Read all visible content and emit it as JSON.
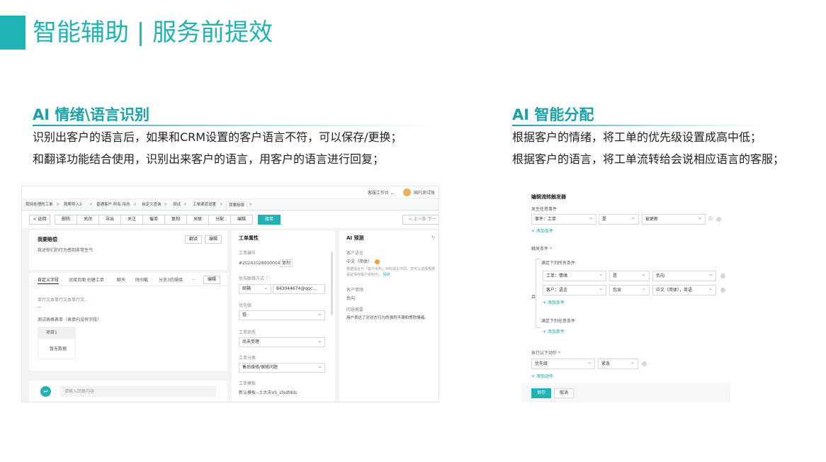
{
  "slide": {
    "title": "智能辅助 | 服务前提效"
  },
  "left_section": {
    "title": "AI 情绪\\语言识别",
    "lines": [
      "识别出客户的语言后，如果和CRM设置的客户语言不符，可以保存/更换；",
      "和翻译功能结合使用，识别出来客户的语言，用客户的语言进行回复；"
    ]
  },
  "right_section": {
    "title": "AI 智能分配",
    "lines": [
      "根据客户的情绪，将工单的优先级设置成高中低；",
      "根据客户的语言，将工单流转给会说相应语言的客服；"
    ]
  },
  "ticket_ui": {
    "topbar": {
      "workspace": "客服工作台 ⌄",
      "user": "国内测试账"
    },
    "tabs": [
      "我待处理的工单",
      "我帮导入2",
      "普通客户·所有·待办",
      "自定义查询",
      "测试",
      "工单渠道设置",
      "我要赔偿"
    ],
    "toolbar": {
      "back": "< 返回",
      "buttons": [
        "删除",
        "关闭",
        "导出",
        "关注",
        "催单",
        "复制",
        "关联",
        "分配",
        "编辑",
        "接单"
      ],
      "pager": "< 上一条 下一"
    },
    "subject": {
      "title": "我要赔偿",
      "body": "我对你们的行为感到非常生气",
      "translate": "翻译",
      "edit": "编辑"
    },
    "detail_tabs": [
      "自定义字段",
      "对接页面·创建工单",
      "聊天",
      "时间截",
      "分支3的操接",
      "···"
    ],
    "detail_edit": "编辑",
    "detail": {
      "field_label": "单行文本单行文本单行文...",
      "field_value": "--",
      "table_label": "测试表格表单（表单内没有字段）",
      "table_header": "项目1",
      "table_empty": "暂无数据"
    },
    "reply_placeholder": "请输入回复内容",
    "attributes": {
      "title": "工单属性",
      "ticket_no_label": "工单编号",
      "ticket_no": "#20241028000004",
      "copy": "复制",
      "contact_label": "优先联络方式 ⓘ",
      "contact_type": "邮箱",
      "contact_value": "843044674@qqc...",
      "priority_label": "优先级",
      "priority": "低",
      "status_label": "工单状态",
      "status": "尚未受理",
      "category_label": "工单分类",
      "category": "售后维修/保修问题",
      "template_label": "工单模板",
      "template": "新认模板--土大夫VS_sfsdfdds"
    },
    "ai_panel": {
      "title": "AI 预测",
      "lang_label": "客户语言",
      "lang_value": "中文（简体）",
      "lang_hint": "根据语言与「客户资料」中的语言不同。您可以选择根据语言保存客户资料中。",
      "lang_action": "保存",
      "emotion_label": "客户情绪",
      "emotion_value": "负向",
      "summary_label": "内容摘要",
      "summary_value": "用户表达了对对方行为的强烈不满和愤怒情绪。"
    }
  },
  "trigger_ui": {
    "title": "编辑流转触发器",
    "event_label": "发生任意事件",
    "event_row": [
      "事件：工单",
      "是",
      "被更新"
    ],
    "add_condition": "+ 添加条件",
    "trigger_label": "触发条件",
    "group_all": "满足下列所有条件",
    "all_rows": [
      [
        "工单：情绪",
        "是",
        "负向"
      ],
      [
        "客户：语言",
        "包含",
        "中文（简体），英语"
      ]
    ],
    "or_label": "且",
    "group_any": "满足下列任意条件",
    "action_label": "执行以下动作",
    "action_row": [
      "优先级",
      "紧急"
    ],
    "add_action": "+ 添加动作",
    "save": "保存",
    "cancel": "取消"
  }
}
